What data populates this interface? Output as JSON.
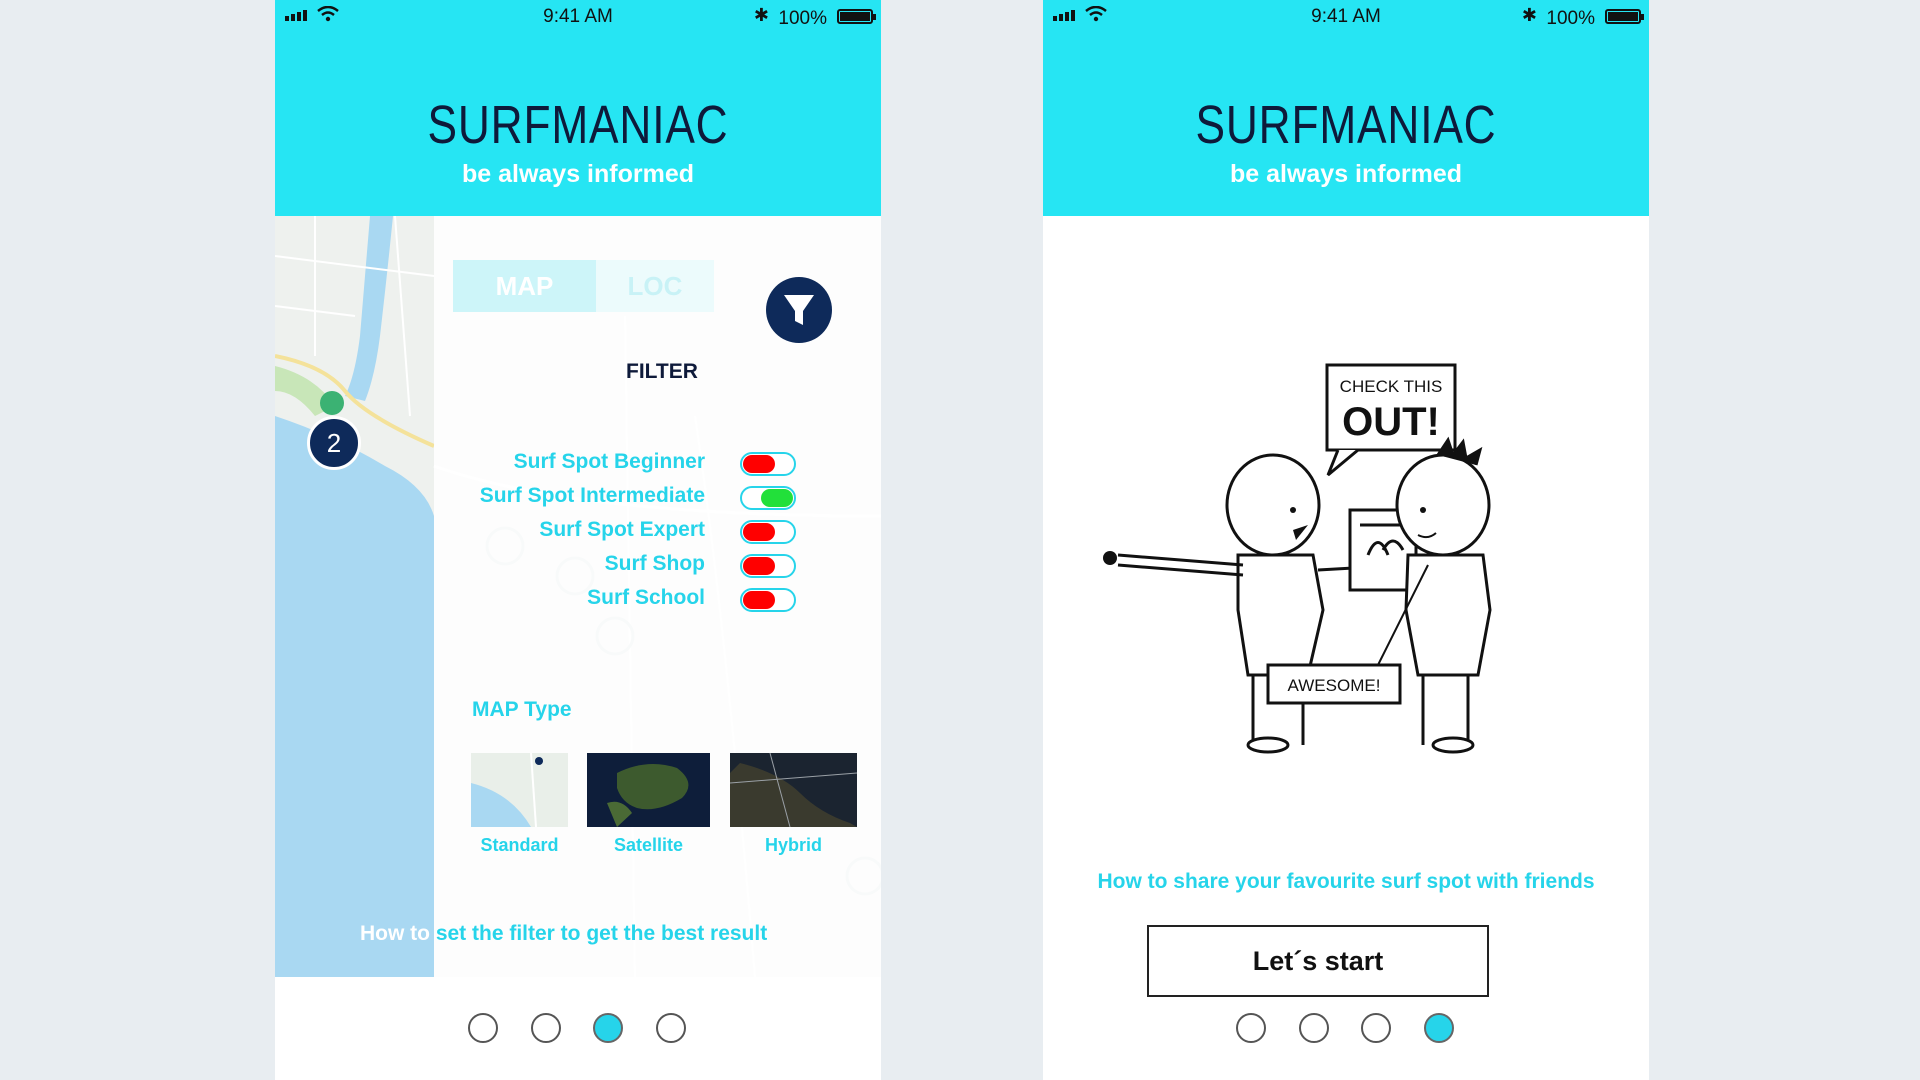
{
  "status_bar": {
    "time": "9:41 AM",
    "battery": "100%"
  },
  "app": {
    "title": "SURFMANIAC",
    "subtitle": "be always informed"
  },
  "left_screen": {
    "tabs": {
      "map": "MAP",
      "loc": "LOC"
    },
    "cluster_count": "2",
    "filter_label": "FILTER",
    "filters": [
      {
        "label": "Surf Spot Beginner",
        "state": "off"
      },
      {
        "label": "Surf Spot Intermediate",
        "state": "on"
      },
      {
        "label": "Surf Spot Expert",
        "state": "off"
      },
      {
        "label": "Surf Shop",
        "state": "off"
      },
      {
        "label": "Surf School",
        "state": "off"
      }
    ],
    "map_type_label": "MAP Type",
    "map_types": [
      "Standard",
      "Satellite",
      "Hybrid"
    ],
    "howto_part1": "How to",
    "howto_part2": " set the filter to get the best result",
    "page_indicator": {
      "pages": 4,
      "active": 3
    }
  },
  "right_screen": {
    "bubble_text_1": "CHECK THIS",
    "bubble_text_2": "OUT!",
    "reply_text": "AWESOME!",
    "howto": "How to share your favourite surf spot with friends",
    "start_button": "Let´s start",
    "page_indicator": {
      "pages": 4,
      "active": 4
    }
  },
  "colors": {
    "accent": "#26e5f3",
    "navy": "#0e2a5a",
    "toggle_off": "#ff0000",
    "toggle_on": "#22e03a"
  }
}
